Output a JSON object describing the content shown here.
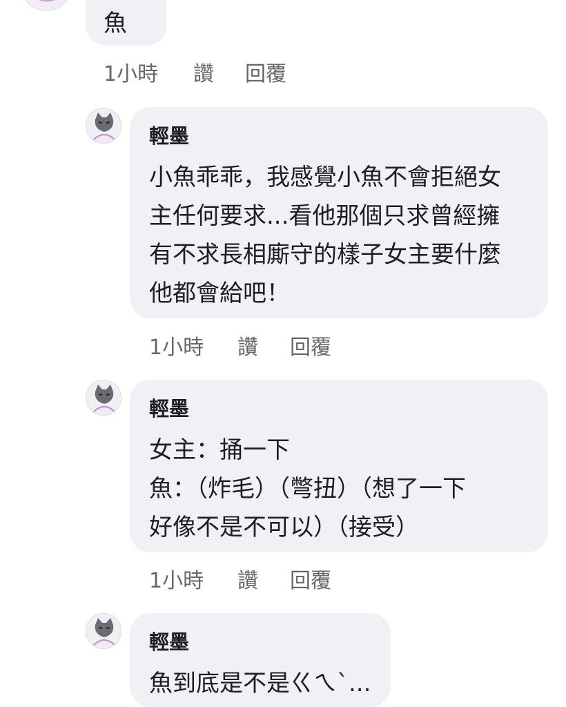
{
  "comments": [
    {
      "author": "",
      "lines": [
        "魚"
      ],
      "meta": {
        "time": "1小時",
        "like": "讚",
        "reply": "回覆"
      }
    },
    {
      "author": "輕墨",
      "lines": [
        "小魚乖乖，我感覺小魚不會拒絕女",
        "主任何要求...看他那個只求曾經擁",
        "有不求長相廝守的樣子女主要什麼",
        "他都會給吧！"
      ],
      "meta": {
        "time": "1小時",
        "like": "讚",
        "reply": "回覆"
      }
    },
    {
      "author": "輕墨",
      "lines": [
        "女主：捅一下",
        "魚：（炸毛）（彆扭）（想了一下",
        "好像不是不可以）（接受）"
      ],
      "meta": {
        "time": "1小時",
        "like": "讚",
        "reply": "回覆"
      }
    },
    {
      "author": "輕墨",
      "lines": [
        "魚到底是不是ㄍㄟˋ..."
      ]
    }
  ],
  "colors": {
    "bubble": "#f0f1f4",
    "meta_text": "#65676b",
    "text": "#1c1e21"
  },
  "icons": {
    "avatar": "cat-avatar-icon"
  }
}
